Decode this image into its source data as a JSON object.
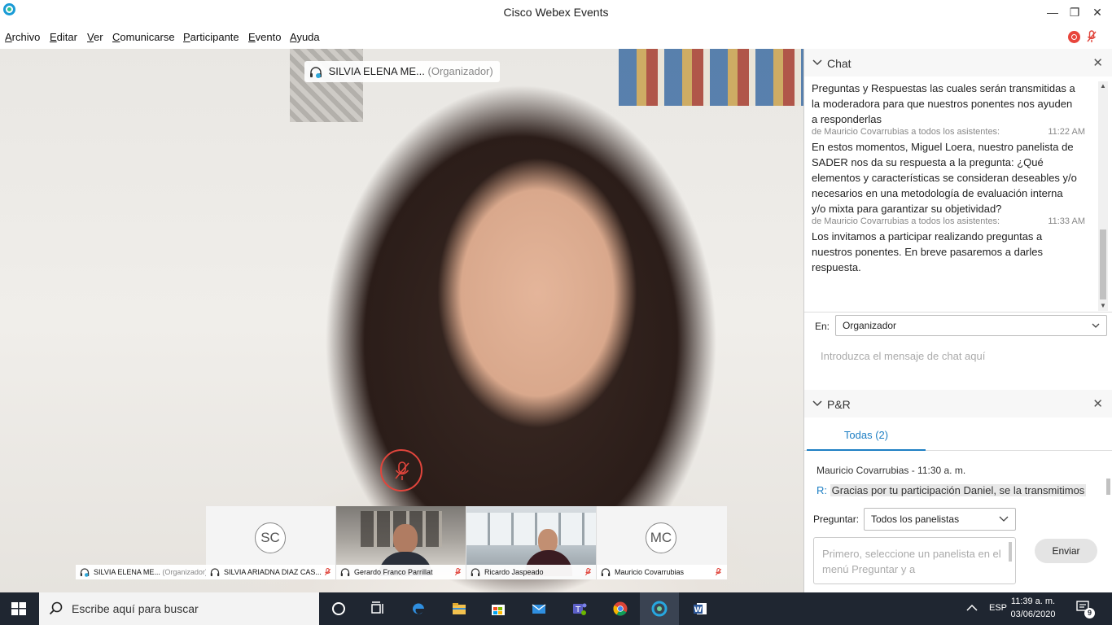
{
  "window": {
    "title": "Cisco Webex Events",
    "minimize": "—",
    "restore": "❐",
    "close": "✕"
  },
  "menu": [
    {
      "first": "A",
      "rest": "rchivo"
    },
    {
      "first": "E",
      "rest": "ditar"
    },
    {
      "first": "V",
      "rest": "er"
    },
    {
      "first": "C",
      "rest": "omunicarse"
    },
    {
      "first": "P",
      "rest": "articipante"
    },
    {
      "first": "E",
      "rest": "vento"
    },
    {
      "first": "A",
      "rest": "yuda"
    }
  ],
  "active_speaker": {
    "name": "SILVIA ELENA ME...",
    "role": "(Organizador)"
  },
  "thumbnails": [
    {
      "name": "SILVIA ELENA ME...",
      "role": "(Organizador)",
      "initials": ""
    },
    {
      "name": "SILVIA ARIADNA DIAZ CAS...",
      "role": "",
      "initials": "SC"
    },
    {
      "name": "Gerardo Franco Parrillat",
      "role": "",
      "initials": ""
    },
    {
      "name": "Ricardo Jaspeado",
      "role": "",
      "initials": ""
    },
    {
      "name": "Mauricio Covarrubias",
      "role": "",
      "initials": "MC"
    }
  ],
  "chat": {
    "title": "Chat",
    "close": "✕",
    "messages": [
      {
        "meta": "",
        "time": "",
        "lines": [
          "Preguntas y Respuestas las cuales serán transmitidas a",
          "la moderadora para que nuestros ponentes nos ayuden",
          "a responderlas"
        ]
      },
      {
        "meta": "de Mauricio Covarrubias a todos los asistentes:",
        "time": "11:22 AM",
        "lines": [
          "En estos momentos, Miguel Loera, nuestro panelista de",
          "SADER nos da su respuesta a la pregunta: ¿Qué",
          "elementos y características se consideran deseables y/o",
          "necesarios en una metodología de evaluación interna",
          "y/o mixta para garantizar su objetividad?"
        ]
      },
      {
        "meta": "de Mauricio Covarrubias a todos los asistentes:",
        "time": "11:33 AM",
        "lines": [
          "Los invitamos a participar realizando preguntas a",
          "nuestros ponentes. En breve pasaremos a darles",
          "respuesta."
        ]
      }
    ],
    "to_label": "En:",
    "to_value": "Organizador",
    "input_placeholder": "Introduzca el mensaje de chat aquí"
  },
  "qa": {
    "title": "P&R",
    "close": "✕",
    "tab_all": "Todas (2)",
    "author": "Mauricio Covarrubias - 11:30 a. m.",
    "answer_prefix": "R:",
    "answer_text": "Gracias por tu participación Daniel, se la transmitimos",
    "ask_label": "Preguntar:",
    "ask_value": "Todos los panelistas",
    "ask_placeholder": "Primero, seleccione un panelista en el menú Preguntar y a",
    "send_label": "Enviar"
  },
  "taskbar": {
    "search_placeholder": "Escribe aquí para buscar",
    "language": "ESP",
    "time": "11:39 a. m.",
    "date": "03/06/2020",
    "notifications": "9"
  },
  "colors": {
    "accent": "#1e7fc4",
    "muted_red": "#e0453c",
    "taskbar": "#1f2631"
  }
}
